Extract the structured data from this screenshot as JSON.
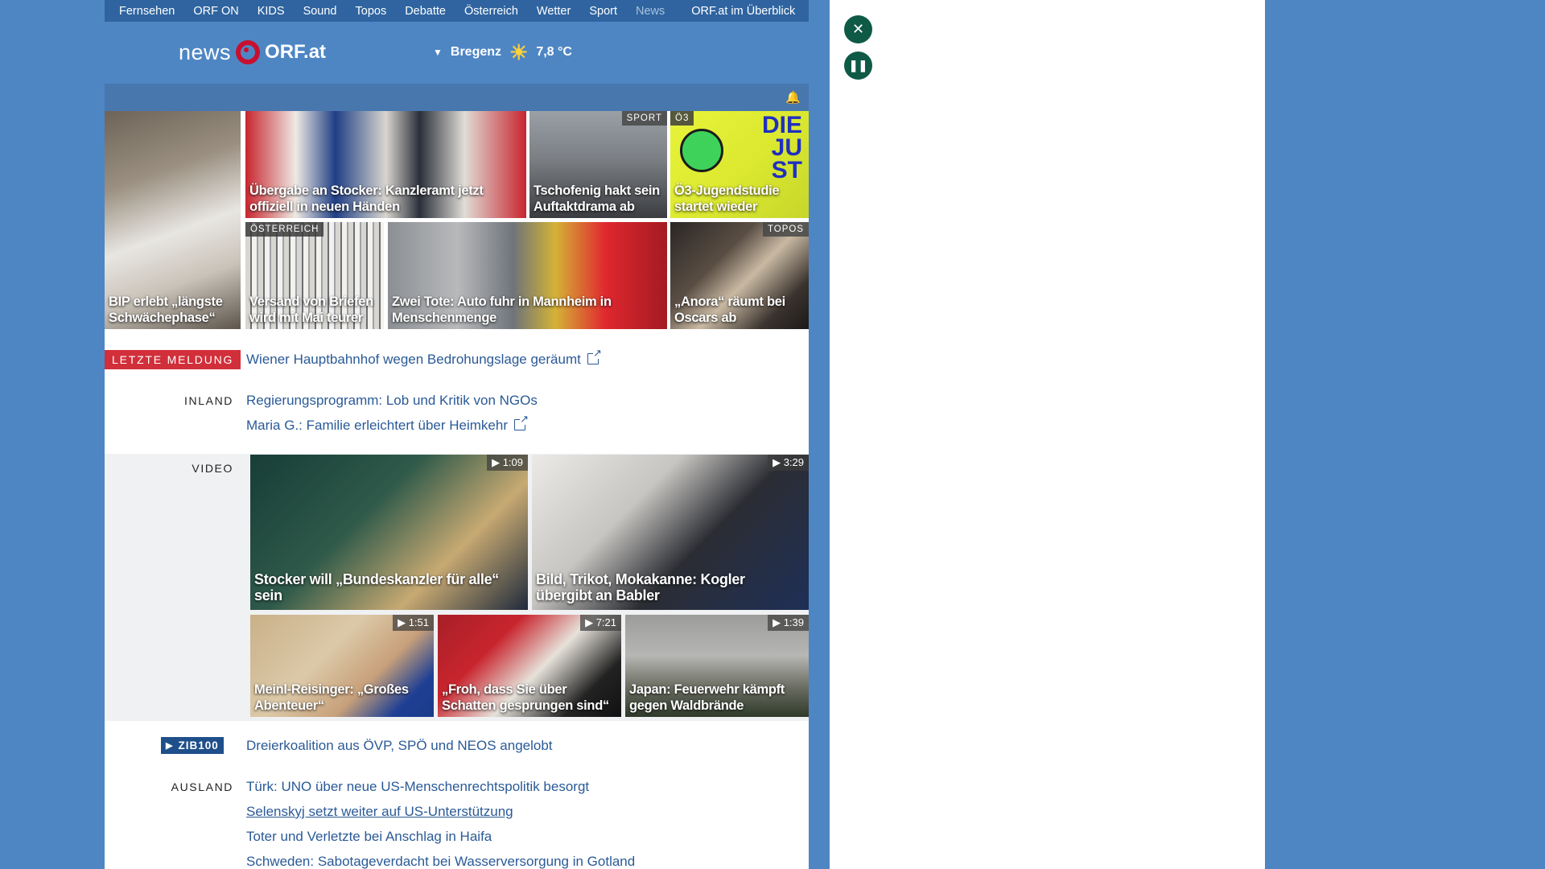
{
  "topnav": [
    "Fernsehen",
    "ORF ON",
    "KIDS",
    "Sound",
    "Topos",
    "Debatte",
    "Österreich",
    "Wetter",
    "Sport",
    "News",
    "ORF.at im Überblick"
  ],
  "logo": {
    "news": "news",
    "orf": "ORF.at"
  },
  "weather": {
    "location": "Bregenz",
    "temp": "7,8 °C",
    "icon": "sun-icon"
  },
  "tiles": [
    {
      "caption": "BIP erlebt „längste Schwächephase“",
      "tag": ""
    },
    {
      "caption": "Übergabe an Stocker: Kanzleramt jetzt offiziell in neuen Händen",
      "tag": ""
    },
    {
      "caption": "Tschofenig hakt sein Auftaktdrama ab",
      "tag": "SPORT"
    },
    {
      "caption": "Ö3-Jugendstudie startet wieder",
      "tag": "Ö3"
    },
    {
      "caption": "Versand von Briefen wird mit Mai teurer",
      "tag": "ÖSTERREICH"
    },
    {
      "caption": "Zwei Tote: Auto fuhr in Mannheim in Menschenmenge",
      "tag": ""
    },
    {
      "caption": "„Anora“ räumt bei Oscars ab",
      "tag": "TOPOS"
    }
  ],
  "breaking": {
    "label": "LETZTE MELDUNG",
    "text": "Wiener Hauptbahnhof wegen Bedrohungslage geräumt"
  },
  "inland": {
    "label": "INLAND",
    "items": [
      "Regierungsprogramm: Lob und Kritik von NGOs",
      "Maria G.: Familie erleichtert über Heimkehr"
    ]
  },
  "video": {
    "label": "VIDEO",
    "items": [
      {
        "caption": "Stocker will „Bundeskanzler für alle“ sein",
        "duration": "1:09"
      },
      {
        "caption": "Bild, Trikot, Mokakanne: Kogler übergibt an Babler",
        "duration": "3:29"
      },
      {
        "caption": "Meinl-Reisinger: „Großes Abenteuer“",
        "duration": "1:51"
      },
      {
        "caption": "„Froh, dass Sie über Schatten gesprungen sind“",
        "duration": "7:21"
      },
      {
        "caption": "Japan: Feuerwehr kämpft gegen Waldbrände",
        "duration": "1:39"
      }
    ]
  },
  "zib": {
    "label": "ZIB",
    "num": "100",
    "text": "Dreierkoalition aus ÖVP, SPÖ und NEOS angelobt"
  },
  "ausland": {
    "label": "AUSLAND",
    "items": [
      "Türk: UNO über neue US-Menschenrechtspolitik besorgt",
      "Selenskyj setzt weiter auf US-Unterstützung",
      "Toter und Verletzte bei Anschlag in Haifa",
      "Schweden: Sabotageverdacht bei Wasserversorgung in Gotland"
    ]
  },
  "colors": {
    "background": "#4e86c4",
    "accent_red": "#d12f3a",
    "link": "#2a5a97",
    "button_green": "#0f5a47"
  }
}
